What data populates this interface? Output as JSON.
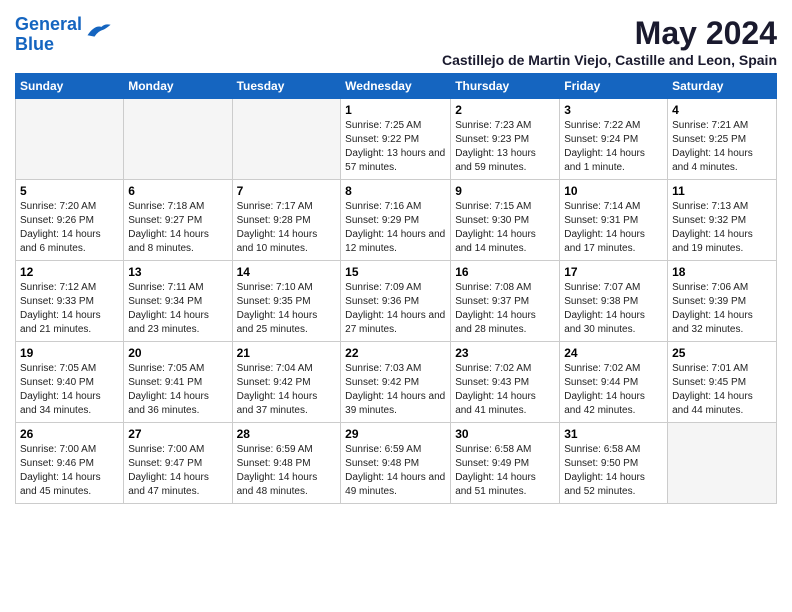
{
  "logo": {
    "line1": "General",
    "line2": "Blue"
  },
  "title": "May 2024",
  "location": "Castillejo de Martin Viejo, Castille and Leon, Spain",
  "days_of_week": [
    "Sunday",
    "Monday",
    "Tuesday",
    "Wednesday",
    "Thursday",
    "Friday",
    "Saturday"
  ],
  "weeks": [
    [
      {
        "day": "",
        "info": ""
      },
      {
        "day": "",
        "info": ""
      },
      {
        "day": "",
        "info": ""
      },
      {
        "day": "1",
        "info": "Sunrise: 7:25 AM\nSunset: 9:22 PM\nDaylight: 13 hours and 57 minutes."
      },
      {
        "day": "2",
        "info": "Sunrise: 7:23 AM\nSunset: 9:23 PM\nDaylight: 13 hours and 59 minutes."
      },
      {
        "day": "3",
        "info": "Sunrise: 7:22 AM\nSunset: 9:24 PM\nDaylight: 14 hours and 1 minute."
      },
      {
        "day": "4",
        "info": "Sunrise: 7:21 AM\nSunset: 9:25 PM\nDaylight: 14 hours and 4 minutes."
      }
    ],
    [
      {
        "day": "5",
        "info": "Sunrise: 7:20 AM\nSunset: 9:26 PM\nDaylight: 14 hours and 6 minutes."
      },
      {
        "day": "6",
        "info": "Sunrise: 7:18 AM\nSunset: 9:27 PM\nDaylight: 14 hours and 8 minutes."
      },
      {
        "day": "7",
        "info": "Sunrise: 7:17 AM\nSunset: 9:28 PM\nDaylight: 14 hours and 10 minutes."
      },
      {
        "day": "8",
        "info": "Sunrise: 7:16 AM\nSunset: 9:29 PM\nDaylight: 14 hours and 12 minutes."
      },
      {
        "day": "9",
        "info": "Sunrise: 7:15 AM\nSunset: 9:30 PM\nDaylight: 14 hours and 14 minutes."
      },
      {
        "day": "10",
        "info": "Sunrise: 7:14 AM\nSunset: 9:31 PM\nDaylight: 14 hours and 17 minutes."
      },
      {
        "day": "11",
        "info": "Sunrise: 7:13 AM\nSunset: 9:32 PM\nDaylight: 14 hours and 19 minutes."
      }
    ],
    [
      {
        "day": "12",
        "info": "Sunrise: 7:12 AM\nSunset: 9:33 PM\nDaylight: 14 hours and 21 minutes."
      },
      {
        "day": "13",
        "info": "Sunrise: 7:11 AM\nSunset: 9:34 PM\nDaylight: 14 hours and 23 minutes."
      },
      {
        "day": "14",
        "info": "Sunrise: 7:10 AM\nSunset: 9:35 PM\nDaylight: 14 hours and 25 minutes."
      },
      {
        "day": "15",
        "info": "Sunrise: 7:09 AM\nSunset: 9:36 PM\nDaylight: 14 hours and 27 minutes."
      },
      {
        "day": "16",
        "info": "Sunrise: 7:08 AM\nSunset: 9:37 PM\nDaylight: 14 hours and 28 minutes."
      },
      {
        "day": "17",
        "info": "Sunrise: 7:07 AM\nSunset: 9:38 PM\nDaylight: 14 hours and 30 minutes."
      },
      {
        "day": "18",
        "info": "Sunrise: 7:06 AM\nSunset: 9:39 PM\nDaylight: 14 hours and 32 minutes."
      }
    ],
    [
      {
        "day": "19",
        "info": "Sunrise: 7:05 AM\nSunset: 9:40 PM\nDaylight: 14 hours and 34 minutes."
      },
      {
        "day": "20",
        "info": "Sunrise: 7:05 AM\nSunset: 9:41 PM\nDaylight: 14 hours and 36 minutes."
      },
      {
        "day": "21",
        "info": "Sunrise: 7:04 AM\nSunset: 9:42 PM\nDaylight: 14 hours and 37 minutes."
      },
      {
        "day": "22",
        "info": "Sunrise: 7:03 AM\nSunset: 9:42 PM\nDaylight: 14 hours and 39 minutes."
      },
      {
        "day": "23",
        "info": "Sunrise: 7:02 AM\nSunset: 9:43 PM\nDaylight: 14 hours and 41 minutes."
      },
      {
        "day": "24",
        "info": "Sunrise: 7:02 AM\nSunset: 9:44 PM\nDaylight: 14 hours and 42 minutes."
      },
      {
        "day": "25",
        "info": "Sunrise: 7:01 AM\nSunset: 9:45 PM\nDaylight: 14 hours and 44 minutes."
      }
    ],
    [
      {
        "day": "26",
        "info": "Sunrise: 7:00 AM\nSunset: 9:46 PM\nDaylight: 14 hours and 45 minutes."
      },
      {
        "day": "27",
        "info": "Sunrise: 7:00 AM\nSunset: 9:47 PM\nDaylight: 14 hours and 47 minutes."
      },
      {
        "day": "28",
        "info": "Sunrise: 6:59 AM\nSunset: 9:48 PM\nDaylight: 14 hours and 48 minutes."
      },
      {
        "day": "29",
        "info": "Sunrise: 6:59 AM\nSunset: 9:48 PM\nDaylight: 14 hours and 49 minutes."
      },
      {
        "day": "30",
        "info": "Sunrise: 6:58 AM\nSunset: 9:49 PM\nDaylight: 14 hours and 51 minutes."
      },
      {
        "day": "31",
        "info": "Sunrise: 6:58 AM\nSunset: 9:50 PM\nDaylight: 14 hours and 52 minutes."
      },
      {
        "day": "",
        "info": ""
      }
    ]
  ]
}
